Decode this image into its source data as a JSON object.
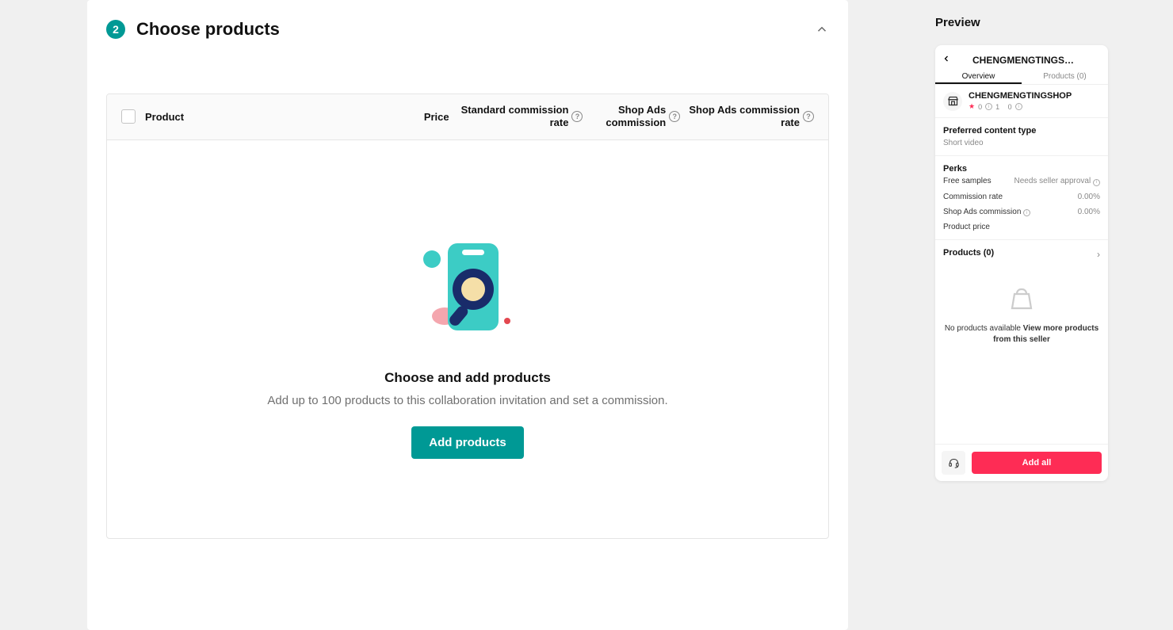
{
  "step": {
    "number": "2",
    "title": "Choose products"
  },
  "table": {
    "headers": {
      "product": "Product",
      "price": "Price",
      "standard_rate": "Standard commission rate",
      "shop_ads": "Shop Ads commission",
      "shop_ads_rate": "Shop Ads commission rate"
    }
  },
  "empty_state": {
    "title": "Choose and add products",
    "subtitle": "Add up to 100 products to this collaboration invitation and set a commission.",
    "button": "Add products"
  },
  "preview": {
    "label": "Preview",
    "header_title": "CHENGMENGTINGS…",
    "tabs": {
      "overview": "Overview",
      "products": "Products (0)"
    },
    "shop": {
      "name": "CHENGMENGTINGSHOP",
      "rating": "0",
      "count1": "1",
      "count2": "0"
    },
    "content_type": {
      "title": "Preferred content type",
      "value": "Short video"
    },
    "perks": {
      "title": "Perks",
      "free_samples_label": "Free samples",
      "free_samples_value": "Needs seller approval",
      "commission_label": "Commission rate",
      "commission_value": "0.00%",
      "shop_ads_label": "Shop Ads commission",
      "shop_ads_value": "0.00%",
      "product_price_label": "Product price"
    },
    "products": {
      "title": "Products (0)",
      "empty_lead": "No products available ",
      "empty_bold": "View more products from this seller"
    },
    "bottom": {
      "add_all": "Add all"
    }
  }
}
